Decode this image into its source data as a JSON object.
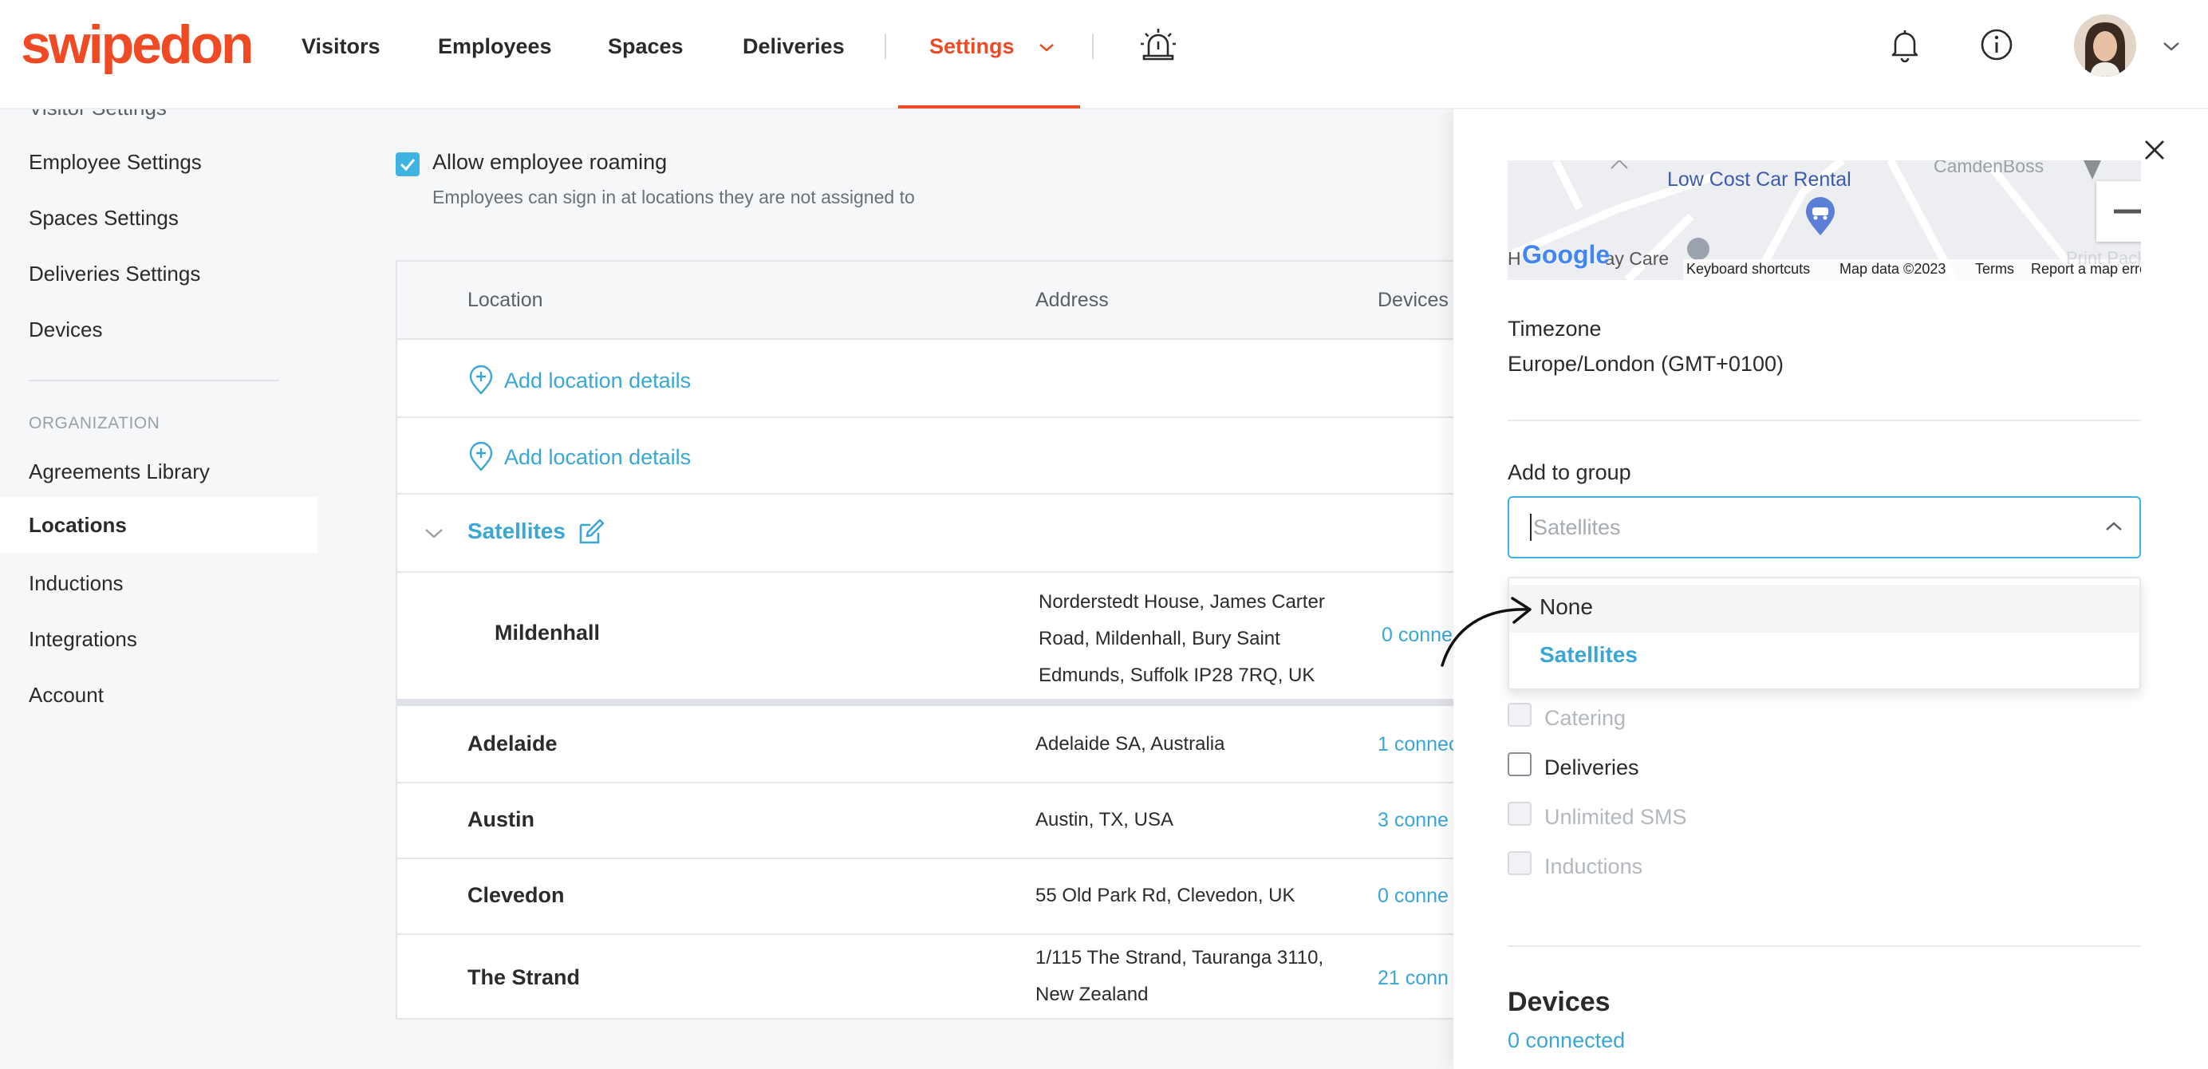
{
  "brand": {
    "logo": "swipedon",
    "color": "#ef4a23",
    "accent": "#3fb3e2"
  },
  "nav": {
    "items": [
      "Visitors",
      "Employees",
      "Spaces",
      "Deliveries"
    ],
    "settings_label": "Settings"
  },
  "sidebar": {
    "items_top": [
      "Visitor Settings",
      "Employee Settings",
      "Spaces Settings",
      "Deliveries Settings",
      "Devices"
    ],
    "section_heading": "ORGANIZATION",
    "items_org": [
      "Agreements Library",
      "Locations",
      "Inductions",
      "Integrations",
      "Account"
    ],
    "active": "Locations"
  },
  "main": {
    "roaming_label": "Allow employee roaming",
    "roaming_help": "Employees can sign in at locations they are not assigned to",
    "roaming_checked": true,
    "table": {
      "headers": [
        "Location",
        "Address",
        "Devices"
      ],
      "add_location": "Add location details",
      "group_name": "Satellites",
      "grouped_row": {
        "name": "Mildenhall",
        "address_lines": [
          "Norderstedt House, James Carter",
          "Road, Mildenhall, Bury Saint",
          "Edmunds, Suffolk IP28 7RQ, UK"
        ],
        "devices": "0 conne"
      },
      "rows": [
        {
          "name": "Adelaide",
          "address_lines": [
            "Adelaide SA, Australia"
          ],
          "devices": "1 connec"
        },
        {
          "name": "Austin",
          "address_lines": [
            "Austin, TX, USA"
          ],
          "devices": "3 conne"
        },
        {
          "name": "Clevedon",
          "address_lines": [
            "55 Old Park Rd, Clevedon, UK"
          ],
          "devices": "0 conne"
        },
        {
          "name": "The Strand",
          "address_lines": [
            "1/115 The Strand, Tauranga 3110,",
            "New Zealand"
          ],
          "devices": "21 conn"
        }
      ]
    }
  },
  "panel": {
    "map": {
      "poi": "Low Cost Car Rental",
      "poi2": "CamdenBoss",
      "google": "Google",
      "left_label_a": "H",
      "left_label_b": "ay Care",
      "right_label": "Print Pack Graf",
      "keyboard_shortcuts": "Keyboard shortcuts",
      "map_data": "Map data ©2023",
      "terms": "Terms",
      "report": "Report a map error"
    },
    "timezone_label": "Timezone",
    "timezone_value": "Europe/London (GMT+0100)",
    "group_label": "Add to group",
    "group_placeholder": "Satellites",
    "dropdown_options": [
      "None",
      "Satellites"
    ],
    "features": [
      {
        "label": "Catering",
        "checked": false,
        "disabled": true
      },
      {
        "label": "Deliveries",
        "checked": false,
        "disabled": false
      },
      {
        "label": "Unlimited SMS",
        "checked": false,
        "disabled": true
      },
      {
        "label": "Inductions",
        "checked": false,
        "disabled": true
      }
    ],
    "devices_heading": "Devices",
    "devices_link": "0 connected"
  }
}
